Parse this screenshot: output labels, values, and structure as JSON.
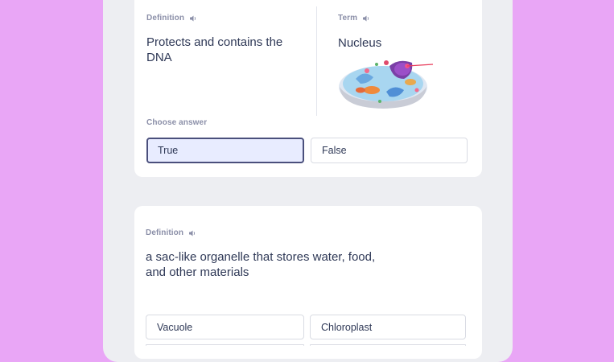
{
  "card1": {
    "definition_label": "Definition",
    "definition_text": "Protects and contains the DNA",
    "term_label": "Term",
    "term_text": "Nucleus",
    "choose_label": "Choose answer",
    "options": [
      "True",
      "False"
    ],
    "selected_option": "True"
  },
  "card2": {
    "definition_label": "Definition",
    "definition_text": "a sac-like organelle that stores water, food, and other materials",
    "options": [
      "Vacuole",
      "Chloroplast"
    ]
  },
  "colors": {
    "background": "#e9a6f6",
    "panel": "#edeef2",
    "text": "#2e3856",
    "muted": "#8b8fa8",
    "selected_fill": "#e8ecff",
    "selected_border": "#4a4f7c"
  },
  "icons": {
    "audio": "speaker-icon",
    "image": "cell-illustration"
  }
}
